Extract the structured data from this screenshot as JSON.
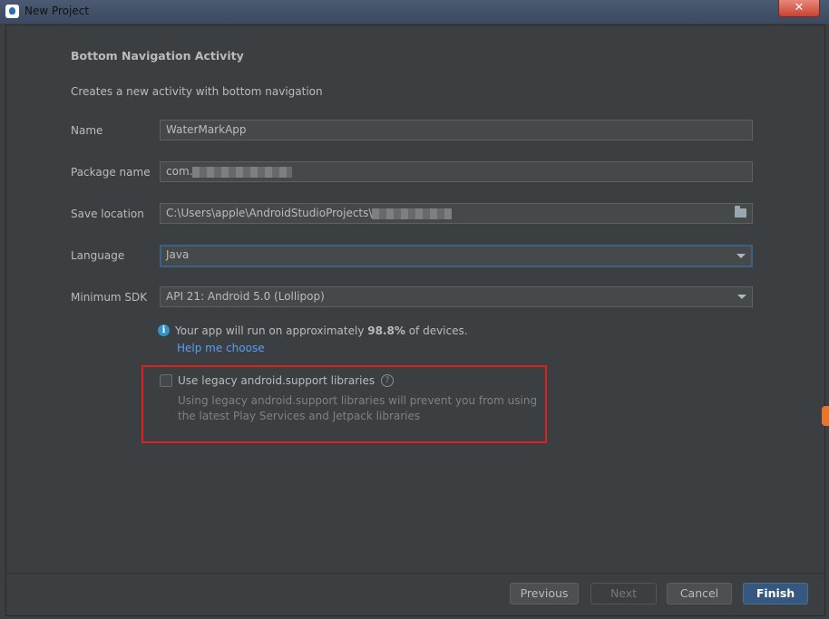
{
  "window": {
    "title": "New Project",
    "close_label": "✕"
  },
  "page": {
    "heading": "Bottom Navigation Activity",
    "subheading": "Creates a new activity with bottom navigation"
  },
  "form": {
    "name": {
      "label": "Name",
      "value": "WaterMarkApp"
    },
    "package": {
      "label": "Package name",
      "value": "com."
    },
    "save_location": {
      "label": "Save location",
      "value": "C:\\Users\\apple\\AndroidStudioProjects\\"
    },
    "language": {
      "label": "Language",
      "value": "Java"
    },
    "min_sdk": {
      "label": "Minimum SDK",
      "value": "API 21: Android 5.0 (Lollipop)"
    }
  },
  "info": {
    "prefix": "Your app will run on approximately ",
    "percent": "98.8%",
    "suffix": " of devices.",
    "help_link": "Help me choose"
  },
  "legacy": {
    "label": "Use legacy android.support libraries",
    "help_glyph": "?",
    "description": "Using legacy android.support libraries will prevent you from using the latest Play Services and Jetpack libraries",
    "checked": false
  },
  "buttons": {
    "previous": "Previous",
    "next": "Next",
    "cancel": "Cancel",
    "finish": "Finish"
  },
  "icons": {
    "info": "info-icon",
    "folder": "folder-icon",
    "dropdown": "chevron-down-icon",
    "help": "question-circle-icon"
  },
  "colors": {
    "background": "#3c3f41",
    "link": "#589df6",
    "primary_button": "#365880",
    "highlight_box": "#e02020"
  }
}
